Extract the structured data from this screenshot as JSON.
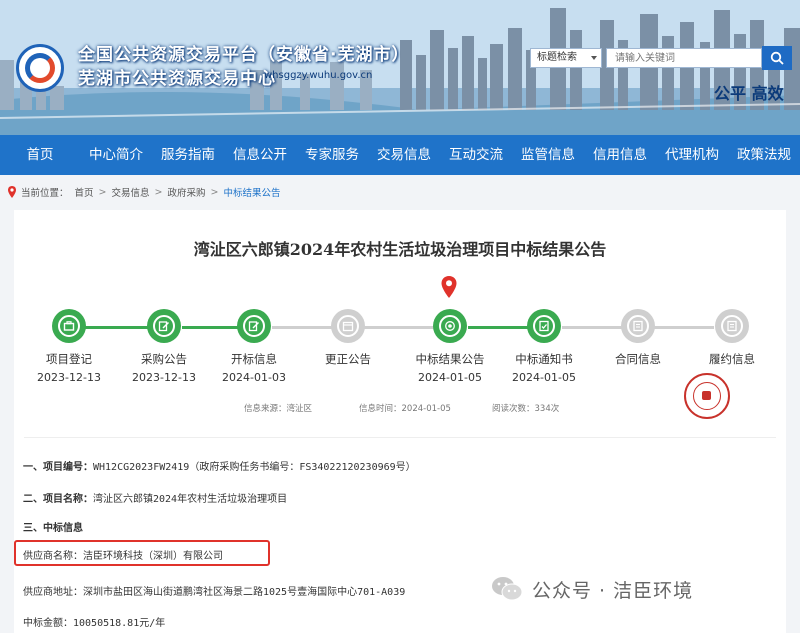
{
  "header": {
    "title_line1": "全国公共资源交易平台（安徽省·芜湖市）",
    "title_line2": "芜湖市公共资源交易中心",
    "domain": "whsggzy.wuhu.gov.cn",
    "search_select": "标题检索",
    "search_placeholder": "请输入关键词",
    "slogan": "公平  高效"
  },
  "nav": {
    "items": [
      "首页",
      "中心简介",
      "服务指南",
      "信息公开",
      "专家服务",
      "交易信息",
      "互动交流",
      "监管信息",
      "信用信息",
      "代理机构",
      "政策法规"
    ]
  },
  "breadcrumb": {
    "items": [
      "当前位置：",
      "首页",
      "交易信息",
      "政府采购",
      "中标结果公告"
    ]
  },
  "article": {
    "title": "湾沚区六郎镇2024年农村生活垃圾治理项目中标结果公告",
    "steps": [
      {
        "label": "项目登记",
        "date": "2023-12-13",
        "state": "done",
        "icon": "briefcase-icon"
      },
      {
        "label": "采购公告",
        "date": "2023-12-13",
        "state": "done",
        "icon": "edit-icon"
      },
      {
        "label": "开标信息",
        "date": "2024-01-03",
        "state": "done",
        "icon": "edit-icon"
      },
      {
        "label": "更正公告",
        "date": "",
        "state": "inactive",
        "icon": "calendar-icon"
      },
      {
        "label": "中标结果公告",
        "date": "2024-01-05",
        "state": "current",
        "icon": "target-icon"
      },
      {
        "label": "中标通知书",
        "date": "2024-01-05",
        "state": "done",
        "icon": "document-icon"
      },
      {
        "label": "合同信息",
        "date": "",
        "state": "inactive",
        "icon": "contract-icon"
      },
      {
        "label": "履约信息",
        "date": "",
        "state": "inactive",
        "icon": "contract-icon"
      }
    ],
    "meta": {
      "source": "信息来源：湾沚区",
      "time": "信息时间：2024-01-05",
      "views": "阅读次数：334次"
    },
    "lines": {
      "item1_label": "一、项目编号：",
      "item1_value": "WH12CG2023FW2419（政府采购任务书编号：FS34022120230969号）",
      "item2_label": "二、项目名称：",
      "item2_value": "湾沚区六郎镇2024年农村生活垃圾治理项目",
      "item3_label": "三、中标信息",
      "supplier": "供应商名称：洁臣环境科技（深圳）有限公司",
      "address": "供应商地址：深圳市盐田区海山街道鹏湾社区海景二路1025号壹海国际中心701-A039",
      "amount": "中标金额：10050518.81元/年"
    }
  },
  "watermark": {
    "text": "公众号 · 洁臣环境"
  },
  "colors": {
    "nav": "#1f73c9",
    "done": "#3aaa50",
    "inactive": "#cfcfcf",
    "marker": "#e0322b",
    "highlight": "#e0322b"
  }
}
